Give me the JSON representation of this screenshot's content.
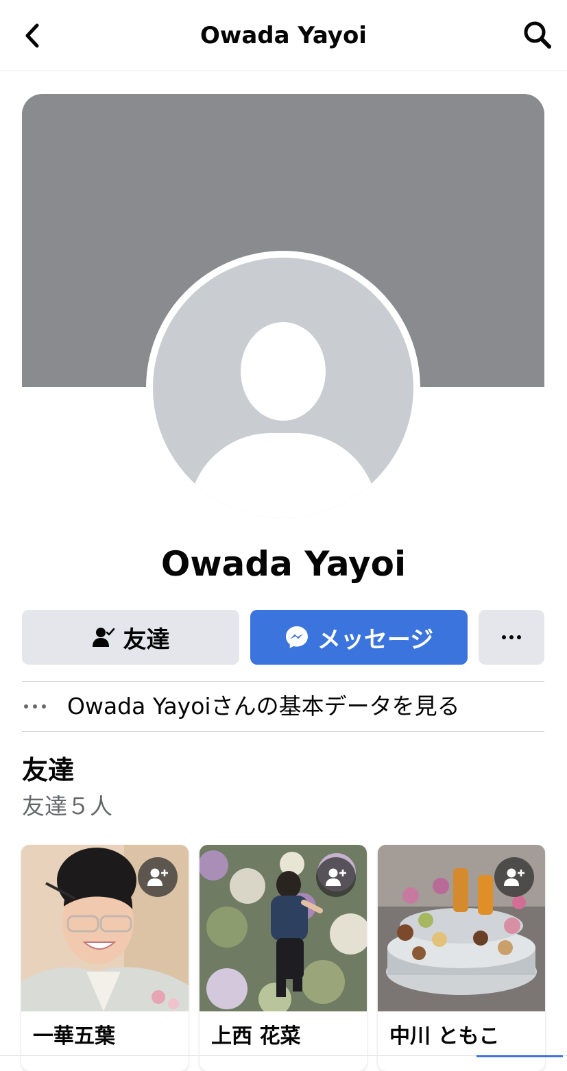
{
  "header": {
    "title": "Owada Yayoi",
    "back_icon": "chevron-left-icon",
    "search_icon": "search-icon"
  },
  "profile": {
    "name": "Owada Yayoi",
    "cover_color": "#8a8b8f",
    "avatar_placeholder_color": "#c9ccd1"
  },
  "actions": {
    "friends_label": "友達",
    "message_label": "メッセージ",
    "more_icon": "more-horizontal-icon",
    "message_color": "#3c74dd"
  },
  "info": {
    "text": "Owada Yayoiさんの基本データを見る"
  },
  "friends_section": {
    "title": "友達",
    "count_text": "友達５人",
    "cards": [
      {
        "name": "一華五葉",
        "photo": "kimono-woman-portrait"
      },
      {
        "name": "上西 花菜",
        "photo": "child-in-flower-garden"
      },
      {
        "name": "中川 ともこ",
        "photo": "dessert-tower"
      }
    ]
  }
}
